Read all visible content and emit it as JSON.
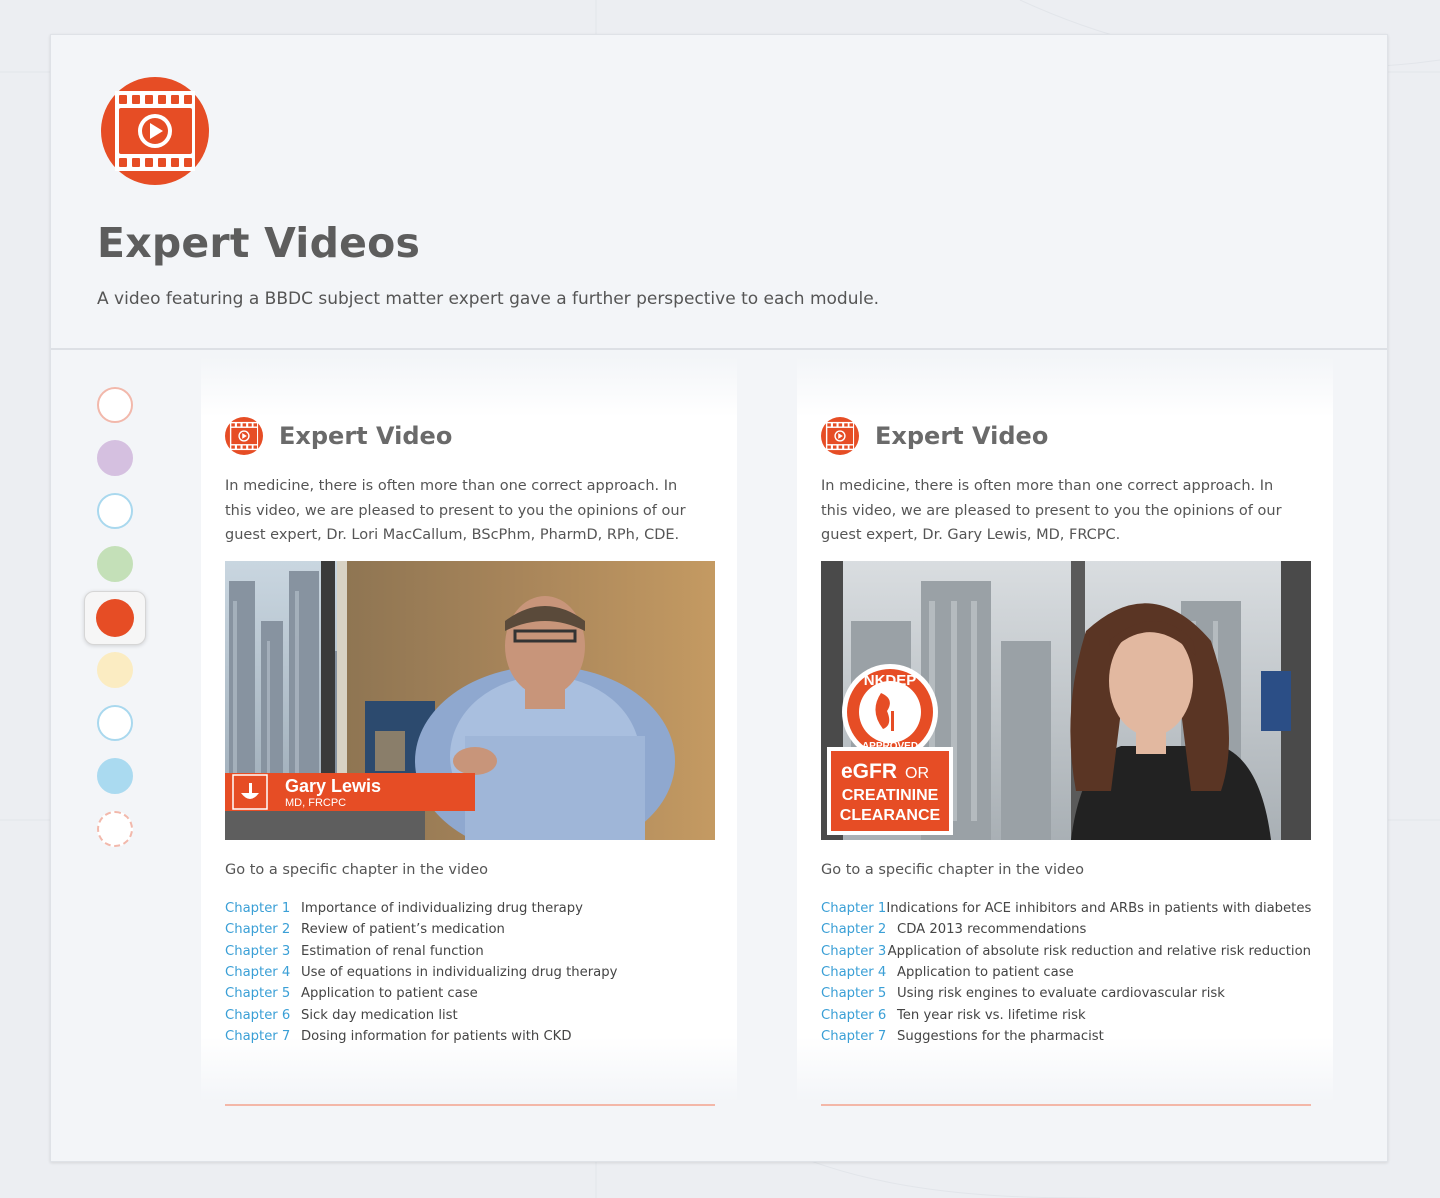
{
  "header": {
    "title": "Expert Videos",
    "subtitle": "A video featuring a BBDC subject matter expert gave a further perspective to each module."
  },
  "module_nav": {
    "dots": [
      {
        "name": "module-dot-1",
        "fill": "#ffffff",
        "stroke": "#f2b8ab"
      },
      {
        "name": "module-dot-2",
        "fill": "#d5c0e0",
        "stroke": "#d5c0e0"
      },
      {
        "name": "module-dot-3",
        "fill": "#ffffff",
        "stroke": "#a9d8ee"
      },
      {
        "name": "module-dot-4",
        "fill": "#c4e0b8",
        "stroke": "#c4e0b8"
      },
      {
        "name": "module-dot-5",
        "fill": "#e64d25",
        "stroke": "#e64d25",
        "active": true
      },
      {
        "name": "module-dot-6",
        "fill": "#fbecc2",
        "stroke": "#fbecc2"
      },
      {
        "name": "module-dot-7",
        "fill": "#ffffff",
        "stroke": "#a9d8ee"
      },
      {
        "name": "module-dot-8",
        "fill": "#aadaf0",
        "stroke": "#aadaf0"
      },
      {
        "name": "module-dot-9",
        "fill": "#ffffff",
        "stroke": "#f2b8ab",
        "shape": "badge"
      }
    ]
  },
  "colors": {
    "accent": "#e64d25",
    "link": "#3a9fd6",
    "rule": "#f3b7a8"
  },
  "cards": [
    {
      "title": "Expert Video",
      "description": "In medicine, there is often more than one correct approach. In this video, we are pleased to present to you the opinions of our guest expert, Dr. Lori MacCallum, BScPhm, PharmD, RPh, CDE.",
      "video": {
        "lower_third_name": "Gary Lewis",
        "lower_third_credentials": "MD, FRCPC"
      },
      "chapter_heading": "Go to a specific chapter in the video",
      "chapters": [
        {
          "link": "Chapter 1",
          "title": "Importance of individualizing drug therapy"
        },
        {
          "link": "Chapter 2",
          "title": "Review of patient’s medication"
        },
        {
          "link": "Chapter 3",
          "title": "Estimation of renal function"
        },
        {
          "link": "Chapter 4",
          "title": "Use of equations in individualizing drug therapy"
        },
        {
          "link": "Chapter 5",
          "title": "Application to patient case"
        },
        {
          "link": "Chapter 6",
          "title": "Sick day medication list"
        },
        {
          "link": "Chapter 7",
          "title": "Dosing information for patients with CKD"
        }
      ]
    },
    {
      "title": "Expert Video",
      "description": "In medicine, there is often more than one correct approach. In this video, we are pleased to present to you the opinions of our guest expert, Dr. Gary Lewis, MD, FRCPC.",
      "video": {
        "badge_top": "NKDEP",
        "badge_bottom": "APPROVED",
        "overlay_line1": "eGFR",
        "overlay_line1_small": "OR",
        "overlay_line2": "CREATININE",
        "overlay_line3": "CLEARANCE"
      },
      "chapter_heading": "Go to a specific chapter in the video",
      "chapters": [
        {
          "link": "Chapter 1",
          "title": "Indications for ACE inhibitors and ARBs in patients with diabetes"
        },
        {
          "link": "Chapter 2",
          "title": "CDA 2013 recommendations"
        },
        {
          "link": "Chapter 3",
          "title": "Application of absolute risk reduction and relative risk reduction"
        },
        {
          "link": "Chapter 4",
          "title": "Application to patient case"
        },
        {
          "link": "Chapter 5",
          "title": "Using risk engines to evaluate cardiovascular risk"
        },
        {
          "link": "Chapter 6",
          "title": "Ten year risk vs. lifetime risk"
        },
        {
          "link": "Chapter 7",
          "title": "Suggestions for the pharmacist"
        }
      ]
    }
  ]
}
